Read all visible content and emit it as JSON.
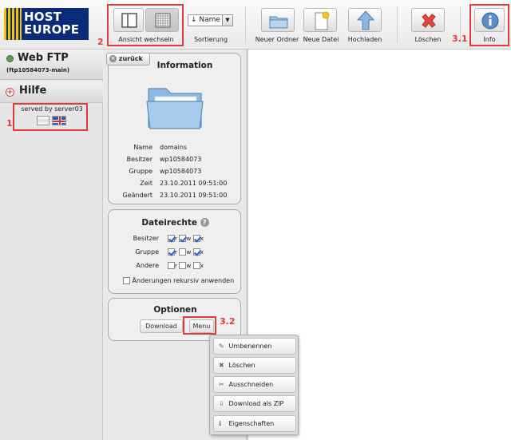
{
  "logo": {
    "line1": "HOST",
    "line2": "EUROPE"
  },
  "toolbar": {
    "view_switch_label": "Ansicht wechseln",
    "sort_value": "↓ Name",
    "sort_label": "Sortierung",
    "new_folder_label": "Neuer Ordner",
    "new_file_label": "Neue Datei",
    "upload_label": "Hochladen",
    "delete_label": "Löschen",
    "info_label": "Info"
  },
  "annotations": {
    "n1": "1",
    "n2": "2",
    "n31": "3.1",
    "n32": "3.2"
  },
  "sidebar": {
    "webftp_title": "Web FTP",
    "account": "(ftp10584073-main)",
    "help_title": "Hilfe",
    "served_by": "served by server03"
  },
  "info_panel": {
    "back_label": "zurück",
    "title": "Information",
    "rows": [
      {
        "key": "Name",
        "value": "domains"
      },
      {
        "key": "Besitzer",
        "value": "wp10584073"
      },
      {
        "key": "Gruppe",
        "value": "wp10584073"
      },
      {
        "key": "Zeit",
        "value": "23.10.2011 09:51:00"
      },
      {
        "key": "Geändert",
        "value": "23.10.2011 09:51:00"
      }
    ]
  },
  "rights_panel": {
    "title": "Dateirechte",
    "rows": [
      {
        "label": "Besitzer",
        "r": true,
        "w": true,
        "x": true
      },
      {
        "label": "Gruppe",
        "r": true,
        "w": false,
        "x": true
      },
      {
        "label": "Andere",
        "r": false,
        "w": false,
        "x": false
      }
    ],
    "flag_r": "r",
    "flag_w": "w",
    "flag_x": "x",
    "recursive_label": "Änderungen rekursiv anwenden"
  },
  "options_panel": {
    "title": "Optionen",
    "download_label": "Download",
    "menu_label": "Menu"
  },
  "context_menu": {
    "items": [
      {
        "icon": "✎",
        "label": "Umbenennen"
      },
      {
        "icon": "✖",
        "label": "Löschen"
      },
      {
        "icon": "✂",
        "label": "Ausschneiden"
      },
      {
        "icon": "⇩",
        "label": "Download als ZIP"
      },
      {
        "icon": "ℹ",
        "label": "Eigenschaften"
      }
    ]
  },
  "colors": {
    "accent_red": "#e23b3b",
    "brand_blue": "#0a2a7a",
    "brand_yellow": "#f2c200"
  }
}
